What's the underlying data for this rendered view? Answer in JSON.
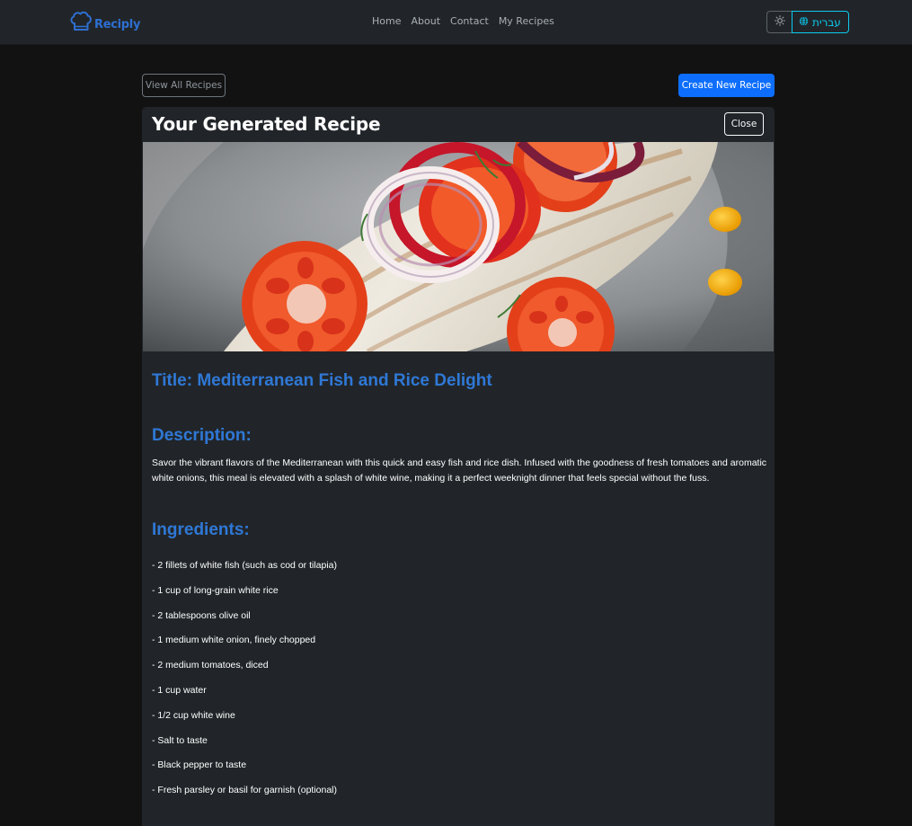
{
  "navbar": {
    "brand": "Reciply",
    "brand_icon": "chef-hat-icon",
    "links": [
      "Home",
      "About",
      "Contact",
      "My Recipes"
    ],
    "theme_icon": "sun-icon",
    "language_label": "עברית",
    "language_icon": "globe-icon"
  },
  "toolbar": {
    "view_all_label": "View All Recipes",
    "create_label": "Create New Recipe"
  },
  "card": {
    "header_title": "Your Generated Recipe",
    "close_label": "Close",
    "image_alt": "grilled-fish-with-tomatoes-and-onions"
  },
  "recipe": {
    "title": "Title: Mediterranean Fish and Rice Delight",
    "description_heading": "Description:",
    "description": "Savor the vibrant flavors of the Mediterranean with this quick and easy fish and rice dish. Infused with the goodness of fresh tomatoes and aromatic white onions, this meal is elevated with a splash of white wine, making it a perfect weeknight dinner that feels special without the fuss.",
    "ingredients_heading": "Ingredients:",
    "ingredients": [
      "- 2 fillets of white fish (such as cod or tilapia)",
      "- 1 cup of long-grain white rice",
      "- 2 tablespoons olive oil",
      "- 1 medium white onion, finely chopped",
      "- 2 medium tomatoes, diced",
      "- 1 cup water",
      "- 1/2 cup white wine",
      "- Salt to taste",
      "- Black pepper to taste",
      "- Fresh parsley or basil for garnish (optional)"
    ]
  },
  "colors": {
    "accent": "#2f78d6",
    "primary_button": "#0d6efd",
    "language_outline": "#0dcaf0",
    "card_background": "#212529",
    "page_background": "#121212"
  }
}
